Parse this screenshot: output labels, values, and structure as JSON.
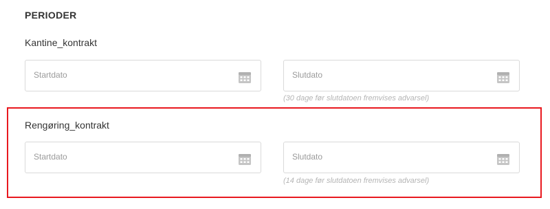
{
  "section": {
    "title": "PERIODER"
  },
  "periods": [
    {
      "name": "Kantine_kontrakt",
      "start_placeholder": "Startdato",
      "end_placeholder": "Slutdato",
      "hint": "(30 dage før slutdatoen fremvises advarsel)"
    },
    {
      "name": "Rengøring_kontrakt",
      "start_placeholder": "Startdato",
      "end_placeholder": "Slutdato",
      "hint": "(14 dage før slutdatoen fremvises advarsel)"
    }
  ],
  "icons": {
    "date_picker": "calendar-icon"
  },
  "colors": {
    "highlight": "#e8181e",
    "field_border": "#d9d9d9",
    "icon": "#c5c5c5"
  }
}
